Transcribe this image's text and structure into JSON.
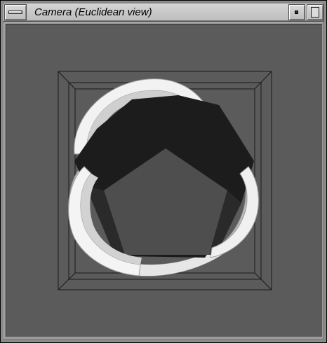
{
  "window": {
    "title": "Camera (Euclidean view)"
  },
  "icons": {
    "window_menu": "window-menu-icon",
    "minimize": "minimize-icon",
    "maximize": "maximize-icon"
  },
  "colors": {
    "viewport_background": "#5b5b5b",
    "wireframe": "#1a1a1a",
    "dark_polygon": "#1c1c1c",
    "inner_pentagon": "#4e4e4e",
    "tube_light": "#f4f4f4",
    "tube_mid": "#cfcfcf",
    "tube_shade": "#a8a8a8"
  }
}
